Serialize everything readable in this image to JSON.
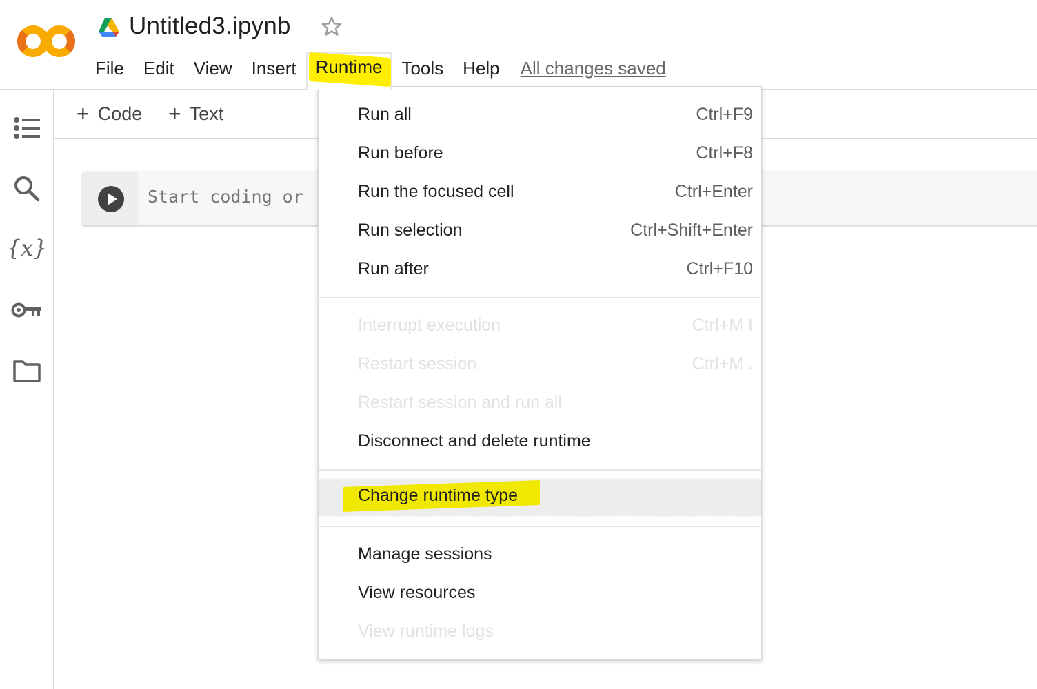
{
  "app": {
    "title": "Untitled3.ipynb",
    "logo_text": "CO",
    "status": "All changes saved"
  },
  "colors": {
    "logo_dark": "#e8711a",
    "logo_light": "#f9ab00",
    "highlight": "#ffee00",
    "menu_active_bg": "#ededed",
    "disabled_text": "#e2e2e2"
  },
  "menubar": {
    "items": [
      {
        "label": "File"
      },
      {
        "label": "Edit"
      },
      {
        "label": "View"
      },
      {
        "label": "Insert"
      },
      {
        "label": "Runtime",
        "open": true
      },
      {
        "label": "Tools"
      },
      {
        "label": "Help"
      }
    ]
  },
  "sidebar": {
    "icons": [
      {
        "name": "table-of-contents-icon"
      },
      {
        "name": "search-icon"
      },
      {
        "name": "variables-icon",
        "glyph": "{x}"
      },
      {
        "name": "secrets-key-icon"
      },
      {
        "name": "files-folder-icon"
      }
    ]
  },
  "toolbar": {
    "add_code_label": "Code",
    "add_text_label": "Text",
    "plus_glyph": "+"
  },
  "cell": {
    "placeholder": "Start coding or"
  },
  "runtime_menu": {
    "groups": [
      [
        {
          "label": "Run all",
          "shortcut": "Ctrl+F9",
          "disabled": false
        },
        {
          "label": "Run before",
          "shortcut": "Ctrl+F8",
          "disabled": false
        },
        {
          "label": "Run the focused cell",
          "shortcut": "Ctrl+Enter",
          "disabled": false
        },
        {
          "label": "Run selection",
          "shortcut": "Ctrl+Shift+Enter",
          "disabled": false
        },
        {
          "label": "Run after",
          "shortcut": "Ctrl+F10",
          "disabled": false
        }
      ],
      [
        {
          "label": "Interrupt execution",
          "shortcut": "Ctrl+M I",
          "disabled": true
        },
        {
          "label": "Restart session",
          "shortcut": "Ctrl+M .",
          "disabled": true
        },
        {
          "label": "Restart session and run all",
          "shortcut": "",
          "disabled": true
        },
        {
          "label": "Disconnect and delete runtime",
          "shortcut": "",
          "disabled": false
        }
      ],
      [
        {
          "label": "Change runtime type",
          "shortcut": "",
          "disabled": false,
          "highlighted": true
        }
      ],
      [
        {
          "label": "Manage sessions",
          "shortcut": "",
          "disabled": false
        },
        {
          "label": "View resources",
          "shortcut": "",
          "disabled": false
        },
        {
          "label": "View runtime logs",
          "shortcut": "",
          "disabled": true
        }
      ]
    ]
  }
}
